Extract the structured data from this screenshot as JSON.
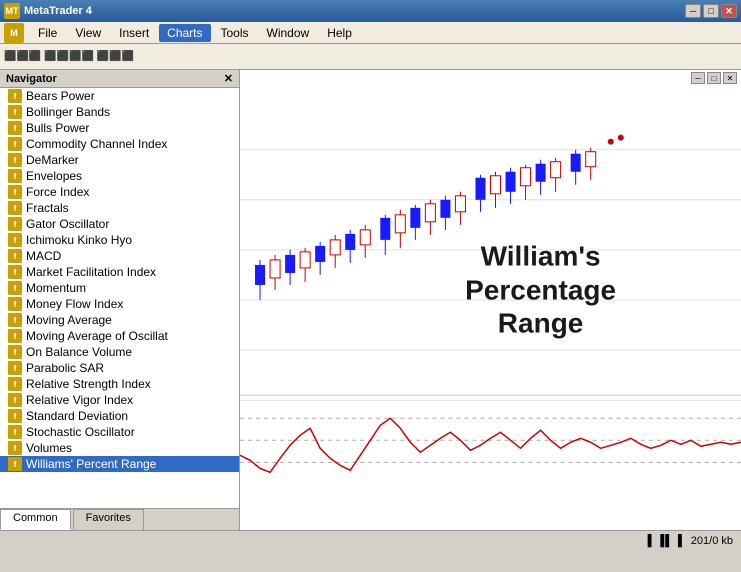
{
  "titleBar": {
    "title": "MetaTrader 4",
    "iconLabel": "MT",
    "minimizeLabel": "─",
    "maximizeLabel": "□",
    "closeLabel": "✕"
  },
  "menuBar": {
    "items": [
      {
        "label": "File",
        "id": "file"
      },
      {
        "label": "View",
        "id": "view"
      },
      {
        "label": "Insert",
        "id": "insert"
      },
      {
        "label": "Charts",
        "id": "charts",
        "active": true
      },
      {
        "label": "Tools",
        "id": "tools"
      },
      {
        "label": "Window",
        "id": "window"
      },
      {
        "label": "Help",
        "id": "help"
      }
    ]
  },
  "navigator": {
    "title": "Navigator",
    "closeLabel": "✕",
    "items": [
      {
        "label": "Bears Power",
        "icon": "f"
      },
      {
        "label": "Bollinger Bands",
        "icon": "f"
      },
      {
        "label": "Bulls Power",
        "icon": "f"
      },
      {
        "label": "Commodity Channel Index",
        "icon": "f"
      },
      {
        "label": "DeMarker",
        "icon": "f"
      },
      {
        "label": "Envelopes",
        "icon": "f"
      },
      {
        "label": "Force Index",
        "icon": "f"
      },
      {
        "label": "Fractals",
        "icon": "f"
      },
      {
        "label": "Gator Oscillator",
        "icon": "f"
      },
      {
        "label": "Ichimoku Kinko Hyo",
        "icon": "f"
      },
      {
        "label": "MACD",
        "icon": "f"
      },
      {
        "label": "Market Facilitation Index",
        "icon": "f"
      },
      {
        "label": "Momentum",
        "icon": "f"
      },
      {
        "label": "Money Flow Index",
        "icon": "f"
      },
      {
        "label": "Moving Average",
        "icon": "f"
      },
      {
        "label": "Moving Average of Oscillat",
        "icon": "f"
      },
      {
        "label": "On Balance Volume",
        "icon": "f"
      },
      {
        "label": "Parabolic SAR",
        "icon": "f"
      },
      {
        "label": "Relative Strength Index",
        "icon": "f"
      },
      {
        "label": "Relative Vigor Index",
        "icon": "f"
      },
      {
        "label": "Standard Deviation",
        "icon": "f"
      },
      {
        "label": "Stochastic Oscillator",
        "icon": "f"
      },
      {
        "label": "Volumes",
        "icon": "f"
      },
      {
        "label": "Williams' Percent Range",
        "icon": "f",
        "selected": true
      }
    ],
    "tabs": [
      {
        "label": "Common",
        "active": true
      },
      {
        "label": "Favorites",
        "active": false
      }
    ]
  },
  "chart": {
    "label": "William's Percentage\nRange",
    "innerControls": [
      "─",
      "□",
      "✕"
    ]
  },
  "statusBar": {
    "chartIcon": "▌▐▌▐",
    "info": "201/0 kb"
  }
}
